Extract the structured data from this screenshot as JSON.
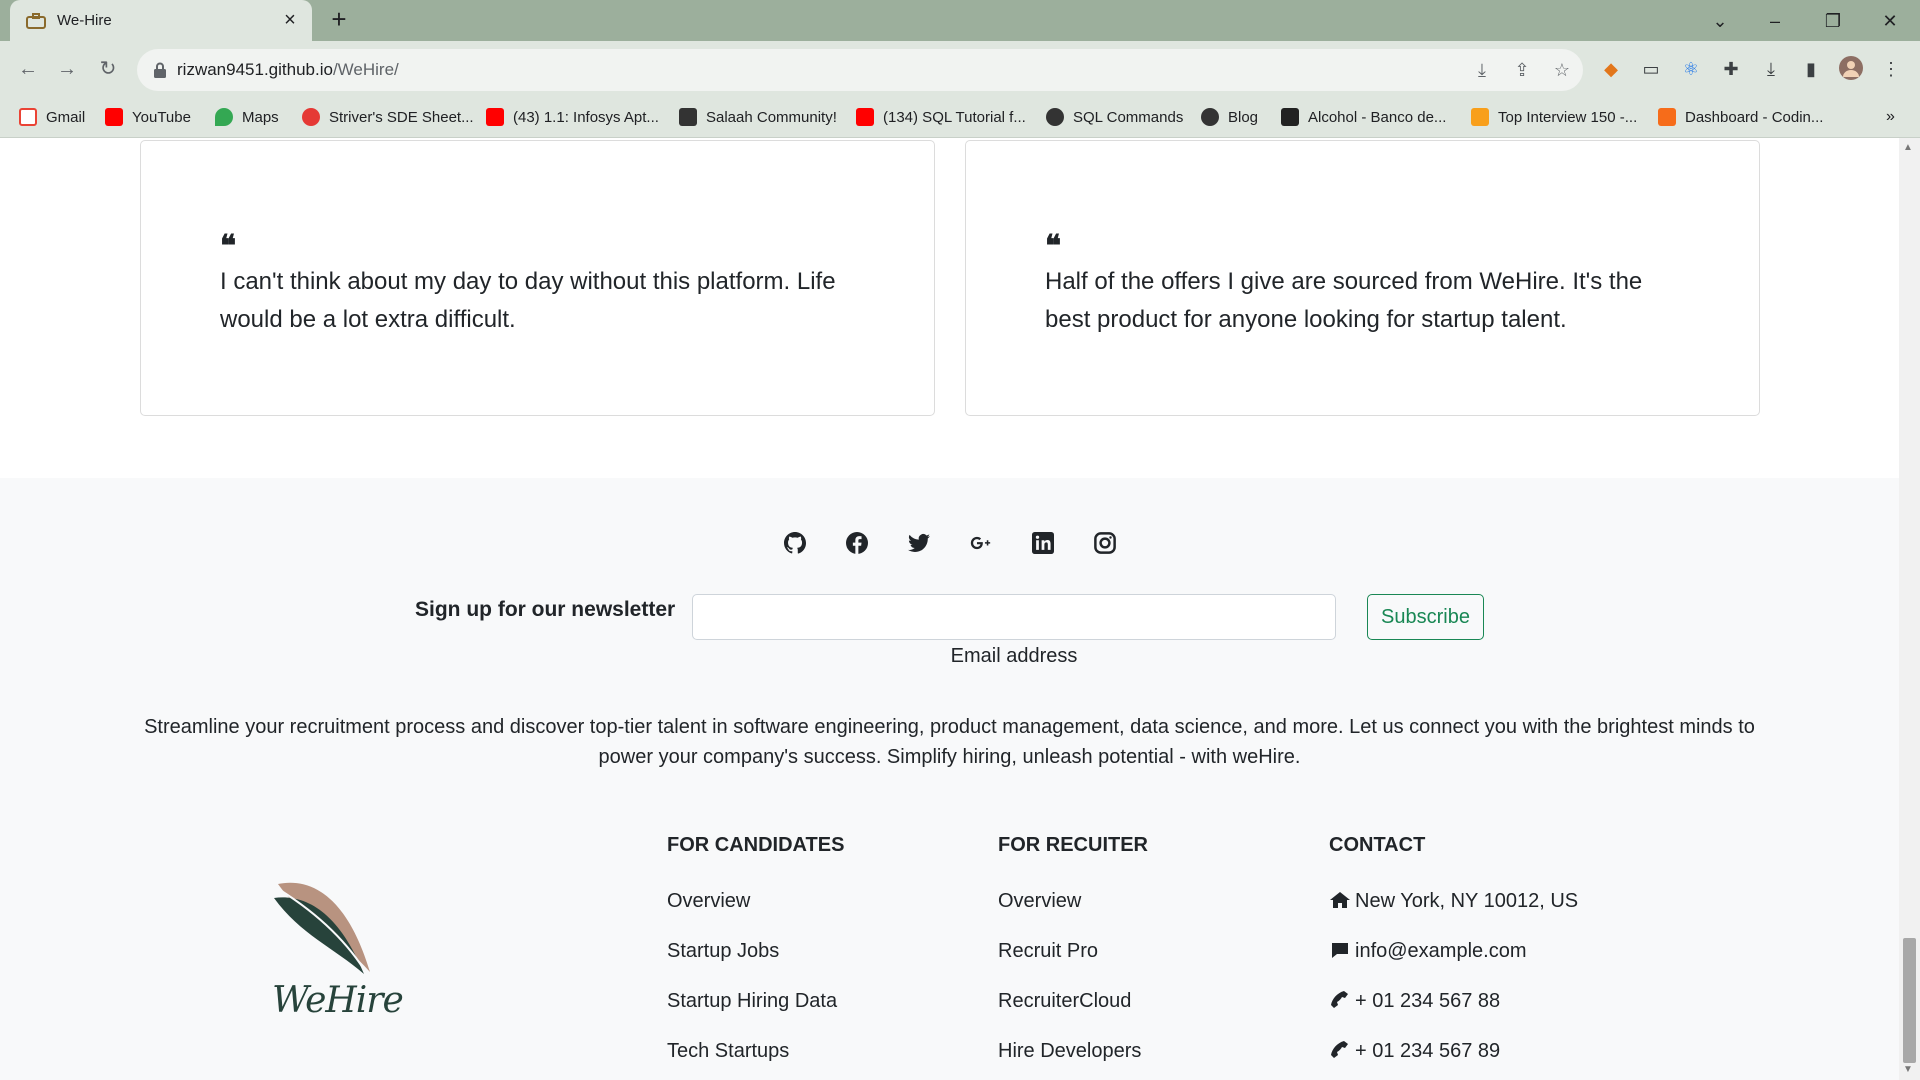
{
  "browser": {
    "tab_title": "We-Hire",
    "url_host": "rizwan9451.github.io",
    "url_path": "/WeHire/"
  },
  "bookmarks": [
    {
      "label": "Gmail",
      "icon": "gmail-icon",
      "color": "#ea4335"
    },
    {
      "label": "YouTube",
      "icon": "youtube-icon",
      "color": "#ff0000"
    },
    {
      "label": "Maps",
      "icon": "maps-icon",
      "color": "#34a853"
    },
    {
      "label": "Striver's SDE Sheet...",
      "icon": "tuf-icon",
      "color": "#e53935"
    },
    {
      "label": "(43) 1.1: Infosys Apt...",
      "icon": "youtube-icon",
      "color": "#ff0000"
    },
    {
      "label": "Salaah Community!",
      "icon": "salaah-icon",
      "color": "#333333"
    },
    {
      "label": "(134) SQL Tutorial f...",
      "icon": "youtube-icon",
      "color": "#ff0000"
    },
    {
      "label": "SQL Commands",
      "icon": "globe-icon",
      "color": "#333333"
    },
    {
      "label": "Blog",
      "icon": "globe-icon",
      "color": "#333333"
    },
    {
      "label": "Alcohol - Banco de...",
      "icon": "s-icon",
      "color": "#222222"
    },
    {
      "label": "Top Interview 150 -...",
      "icon": "leetcode-icon",
      "color": "#f89f1b"
    },
    {
      "label": "Dashboard - Codin...",
      "icon": "codingninjas-icon",
      "color": "#f66c1a"
    }
  ],
  "testimonials": [
    {
      "text": "I can't think about my day to day without this platform. Life would be a lot extra difficult."
    },
    {
      "text": "Half of the offers I give are sourced from WeHire. It's the best product for anyone looking for startup talent."
    }
  ],
  "newsletter": {
    "label": "Sign up for our newsletter",
    "input_value": "",
    "help": "Email address",
    "button": "Subscribe"
  },
  "blurb": "Streamline your recruitment process and discover top-tier talent in software engineering, product management, data science, and more. Let us connect you with the brightest minds to power your company's success. Simplify hiring, unleash potential - with weHire.",
  "logo_text": "WeHire",
  "columns": {
    "candidates": {
      "title": "FOR CANDIDATES",
      "links": [
        "Overview",
        "Startup Jobs",
        "Startup Hiring Data",
        "Tech Startups"
      ]
    },
    "recruiter": {
      "title": "FOR RECUITER",
      "links": [
        "Overview",
        "Recruit Pro",
        "RecruiterCloud",
        "Hire Developers"
      ]
    },
    "contact": {
      "title": "CONTACT",
      "links": [
        "New York, NY 10012, US",
        "info@example.com",
        "+ 01 234 567 88",
        "+ 01 234 567 89"
      ]
    }
  },
  "colors": {
    "accent": "#198754",
    "footer_bg": "#f8f9fa",
    "chrome": "#dfe6df"
  }
}
